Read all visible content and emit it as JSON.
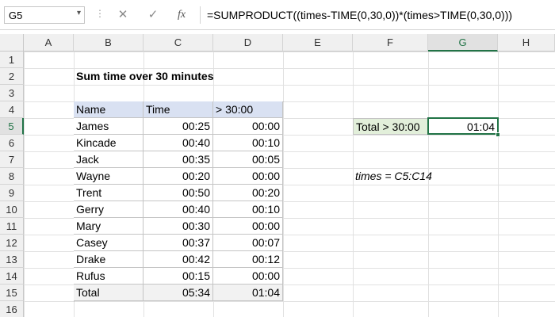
{
  "formula_bar": {
    "name_box": "G5",
    "name_box_arrow": "▾",
    "separator": "⋮",
    "cancel_glyph": "✕",
    "enter_glyph": "✓",
    "fx_glyph": "fx",
    "formula": "=SUMPRODUCT((times-TIME(0,30,0))*(times>TIME(0,30,0)))"
  },
  "columns": [
    "A",
    "B",
    "C",
    "D",
    "E",
    "F",
    "G",
    "H"
  ],
  "rows": [
    "1",
    "2",
    "3",
    "4",
    "5",
    "6",
    "7",
    "8",
    "9",
    "10",
    "11",
    "12",
    "13",
    "14",
    "15",
    "16"
  ],
  "selected_column": "G",
  "selected_row": "5",
  "title": "Sum time over 30 minutes",
  "table": {
    "headers": [
      "Name",
      "Time",
      "> 30:00"
    ],
    "rows": [
      {
        "name": "James",
        "time": "00:25",
        "over": "00:00"
      },
      {
        "name": "Kincade",
        "time": "00:40",
        "over": "00:10"
      },
      {
        "name": "Jack",
        "time": "00:35",
        "over": "00:05"
      },
      {
        "name": "Wayne",
        "time": "00:20",
        "over": "00:00"
      },
      {
        "name": "Trent",
        "time": "00:50",
        "over": "00:20"
      },
      {
        "name": "Gerry",
        "time": "00:40",
        "over": "00:10"
      },
      {
        "name": "Mary",
        "time": "00:30",
        "over": "00:00"
      },
      {
        "name": "Casey",
        "time": "00:37",
        "over": "00:07"
      },
      {
        "name": "Drake",
        "time": "00:42",
        "over": "00:12"
      },
      {
        "name": "Rufus",
        "time": "00:15",
        "over": "00:00"
      }
    ],
    "total": {
      "name": "Total",
      "time": "05:34",
      "over": "01:04"
    }
  },
  "summary": {
    "label": "Total > 30:00",
    "value": "01:04"
  },
  "note": "times = C5:C14",
  "colors": {
    "header_fill": "#d9e1f2",
    "label_fill": "#e2efda",
    "total_fill": "#f2f2f2",
    "selection": "#217346"
  }
}
